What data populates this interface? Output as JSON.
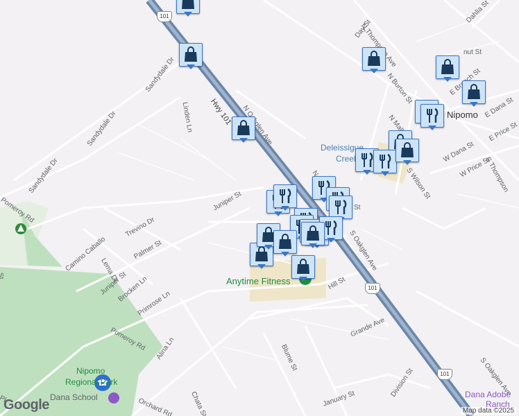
{
  "map": {
    "attribution": "Map data ©2025",
    "logo": "Google",
    "streets": [
      "N Thompson Ave",
      "Day St",
      "Dahlia St",
      "N Burton St",
      "E Branch St",
      "E Dana St",
      "E Price St",
      "S Thompson",
      "N Mallagh St",
      "W Dana St",
      "W Price St",
      "S Wilson St",
      "N Oakglen Ave",
      "S Oakglen Ave",
      "Hwy 101",
      "Sandydale Dr",
      "Linden Ln",
      "Juniper St",
      "Trevino Dr",
      "Camino Caballo",
      "Palmer St",
      "Lema Dr",
      "Brocken Ln",
      "Primrose Ln",
      "Pomeroy Rd",
      "Alina Ln",
      "Chata St",
      "Orchard Rd",
      "Blume St",
      "Grande Ave",
      "Hill St",
      "January St",
      "Division St",
      "Dana Adobe",
      "Ranch",
      "Nipomo",
      "Deleissigue",
      "Creek",
      "N O",
      "St",
      "nut St",
      "Nipomo",
      "Regional Park",
      "Dana School",
      "Pl"
    ],
    "pois": [
      "Anytime Fitness",
      "Nipomo Regional Park",
      "Dana School"
    ],
    "shield_number": "101",
    "markers": [
      "shopping-bag",
      "shopping-bag",
      "shopping-bag",
      "shopping-bag",
      "shopping-bag",
      "shopping-bag",
      "fork-knife",
      "fork-knife",
      "fork-knife",
      "fork-knife",
      "fork-knife",
      "fork-knife",
      "fork-knife",
      "fork-knife",
      "fork-knife",
      "shopping-bag",
      "fork-knife",
      "fork-knife",
      "shopping-bag",
      "shopping-bag",
      "fork-knife",
      "fork-knife",
      "shopping-bag",
      "shopping-bag"
    ],
    "colors": {
      "background": "#f3f1f3",
      "park": "#bfe0bf",
      "highway": "#7f98b8",
      "marker_fill": "#cde4f7",
      "marker_border": "#3d76c4",
      "icon": "#1a3a5c",
      "poi_text": "#1e8e3e"
    }
  }
}
